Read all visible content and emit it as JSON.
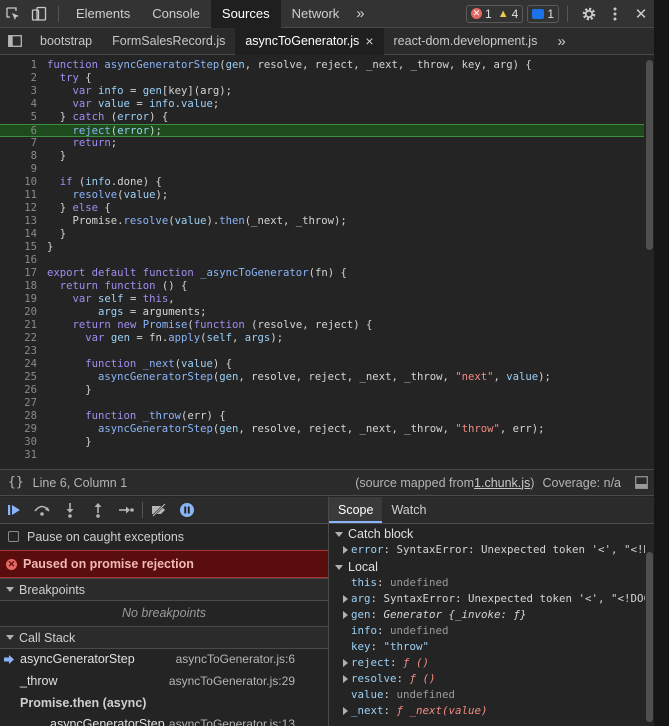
{
  "toolbar": {
    "tabs": [
      "Elements",
      "Console",
      "Sources",
      "Network"
    ],
    "active_tab": "Sources",
    "more_tabs": "»",
    "errors": "1",
    "warnings": "4",
    "messages": "1",
    "close": "✕"
  },
  "file_tabs": {
    "files": [
      "bootstrap",
      "FormSalesRecord.js",
      "asyncToGenerator.js",
      "react-dom.development.js"
    ],
    "active": "asyncToGenerator.js",
    "close": "×",
    "more": "»"
  },
  "editor": {
    "highlighted_line": 6,
    "lines": [
      {
        "n": "1",
        "text": "function asyncGeneratorStep(gen, resolve, reject, _next, _throw, key, arg) {"
      },
      {
        "n": "2",
        "text": "  try {"
      },
      {
        "n": "3",
        "text": "    var info = gen[key](arg);"
      },
      {
        "n": "4",
        "text": "    var value = info.value;"
      },
      {
        "n": "5",
        "text": "  } catch (error) {"
      },
      {
        "n": "6",
        "text": "    reject(error);"
      },
      {
        "n": "7",
        "text": "    return;"
      },
      {
        "n": "8",
        "text": "  }"
      },
      {
        "n": "9",
        "text": ""
      },
      {
        "n": "10",
        "text": "  if (info.done) {"
      },
      {
        "n": "11",
        "text": "    resolve(value);"
      },
      {
        "n": "12",
        "text": "  } else {"
      },
      {
        "n": "13",
        "text": "    Promise.resolve(value).then(_next, _throw);"
      },
      {
        "n": "14",
        "text": "  }"
      },
      {
        "n": "15",
        "text": "}"
      },
      {
        "n": "16",
        "text": ""
      },
      {
        "n": "17",
        "text": "export default function _asyncToGenerator(fn) {"
      },
      {
        "n": "18",
        "text": "  return function () {"
      },
      {
        "n": "19",
        "text": "    var self = this,"
      },
      {
        "n": "20",
        "text": "        args = arguments;"
      },
      {
        "n": "21",
        "text": "    return new Promise(function (resolve, reject) {"
      },
      {
        "n": "22",
        "text": "      var gen = fn.apply(self, args);"
      },
      {
        "n": "23",
        "text": ""
      },
      {
        "n": "24",
        "text": "      function _next(value) {"
      },
      {
        "n": "25",
        "text": "        asyncGeneratorStep(gen, resolve, reject, _next, _throw, \"next\", value);"
      },
      {
        "n": "26",
        "text": "      }"
      },
      {
        "n": "27",
        "text": ""
      },
      {
        "n": "28",
        "text": "      function _throw(err) {"
      },
      {
        "n": "29",
        "text": "        asyncGeneratorStep(gen, resolve, reject, _next, _throw, \"throw\", err);"
      },
      {
        "n": "30",
        "text": "      }"
      },
      {
        "n": "31",
        "text": ""
      }
    ]
  },
  "status": {
    "position": "Line 6, Column 1",
    "source_prefix": "(source mapped from ",
    "source_link": "1.chunk.js",
    "source_suffix": ")",
    "coverage": "Coverage: n/a"
  },
  "debugger": {
    "pause_on_caught": "Pause on caught exceptions",
    "paused_message": "Paused on promise rejection",
    "breakpoints_header": "Breakpoints",
    "no_breakpoints": "No breakpoints",
    "call_stack_header": "Call Stack",
    "frames": [
      {
        "name": "asyncGeneratorStep",
        "location": "asyncToGenerator.js:6",
        "current": true
      },
      {
        "name": "_throw",
        "location": "asyncToGenerator.js:29",
        "current": false
      }
    ],
    "async_separator": "Promise.then (async)",
    "partial_frame": {
      "name": "asyncGeneratorStep",
      "location": "asyncToGenerator.js:13"
    }
  },
  "scope": {
    "tabs": [
      "Scope",
      "Watch"
    ],
    "active_tab": "Scope",
    "sections": [
      {
        "title": "Catch block",
        "vars": [
          {
            "name": "error",
            "value": "SyntaxError: Unexpected token '<', \"<!DOCTYPE \"... is not valid JSON",
            "expandable": true
          }
        ]
      },
      {
        "title": "Local",
        "vars": [
          {
            "name": "this",
            "value": "undefined",
            "expandable": false
          },
          {
            "name": "arg",
            "value": "SyntaxError: Unexpected token '<', \"<!DOCTYPE \"... is not valid JSON",
            "expandable": true
          },
          {
            "name": "gen",
            "value": "Generator {_invoke: ƒ}",
            "expandable": true
          },
          {
            "name": "info",
            "value": "undefined",
            "expandable": false
          },
          {
            "name": "key",
            "value": "\"throw\"",
            "expandable": false
          },
          {
            "name": "reject",
            "value": "ƒ ()",
            "expandable": true
          },
          {
            "name": "resolve",
            "value": "ƒ ()",
            "expandable": true
          },
          {
            "name": "value",
            "value": "undefined",
            "expandable": false
          },
          {
            "name": "_next",
            "value": "ƒ _next(value)",
            "expandable": true
          }
        ]
      }
    ]
  },
  "colors": {
    "accent": "#8ab4f8",
    "error": "#f28b82",
    "highlight_line": "#1e4a1e",
    "paused_bg": "#5a0d0d"
  }
}
